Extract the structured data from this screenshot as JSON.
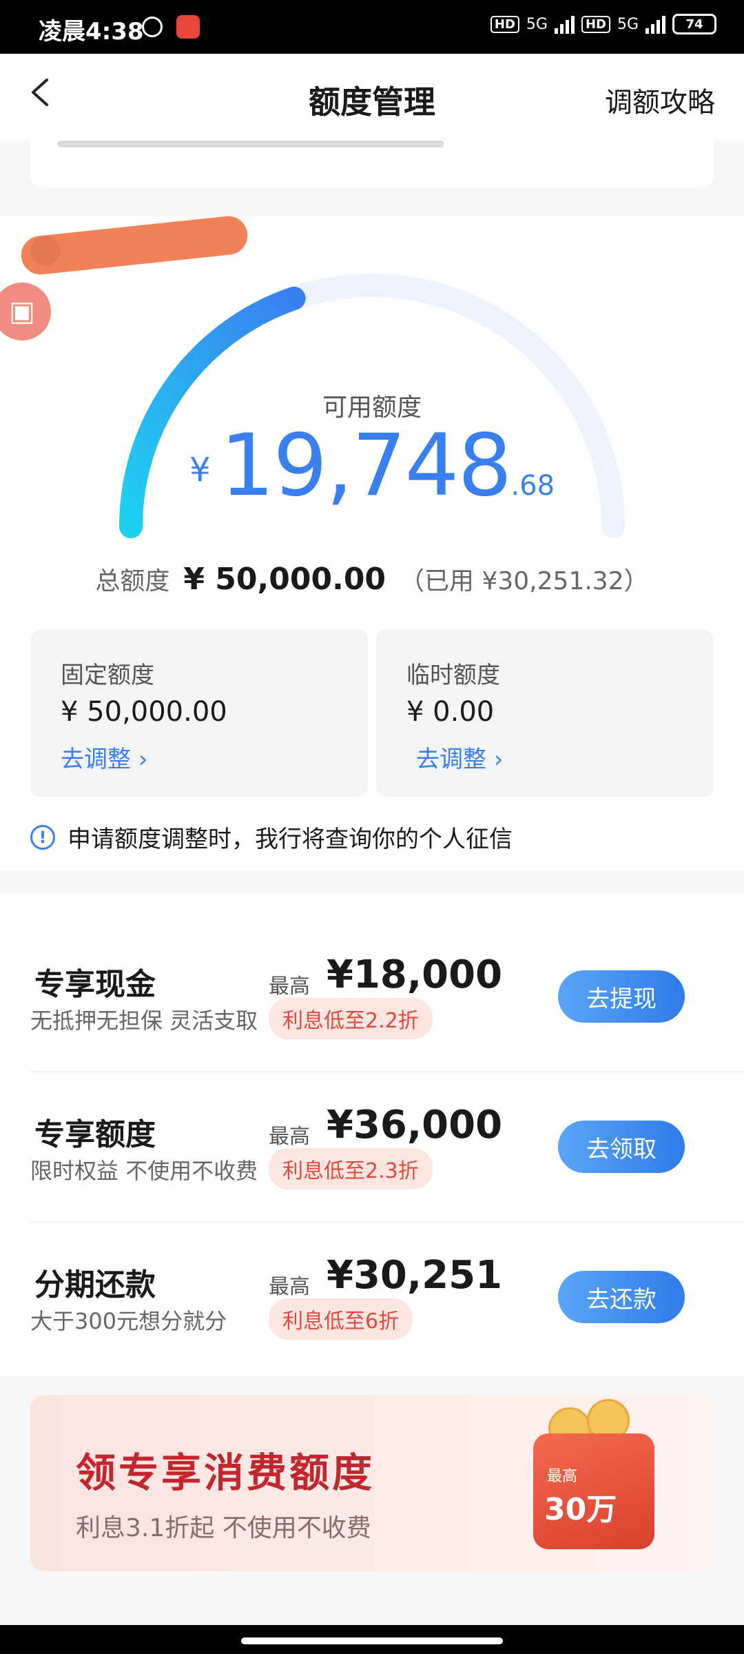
{
  "status_bar": {
    "time": "凌晨4:38",
    "hd1": "HD",
    "net1": "5G",
    "hd2": "HD",
    "net2": "5G",
    "battery": "74"
  },
  "header": {
    "title": "额度管理",
    "right_link": "调额攻略"
  },
  "credit": {
    "available_label": "可用额度",
    "available_currency": "¥",
    "available_int": "19,748",
    "available_dec": ".68",
    "available_fraction_of_total": 0.395,
    "total_label": "总额度",
    "total_value": "¥ 50,000.00",
    "used_text": "（已用 ¥30,251.32）"
  },
  "boxes": [
    {
      "title": "固定额度",
      "value": "¥ 50,000.00",
      "action": "去调整"
    },
    {
      "title": "临时额度",
      "value": "¥ 0.00",
      "action": "去调整"
    }
  ],
  "notice": "申请额度调整时，我行将查询你的个人征信",
  "offers": [
    {
      "name": "专享现金",
      "desc": "无抵押无担保 灵活支取",
      "max_label": "最高",
      "amount": "¥18,000",
      "rate": "利息低至2.2折",
      "button": "去提现"
    },
    {
      "name": "专享额度",
      "desc": "限时权益 不使用不收费",
      "max_label": "最高",
      "amount": "¥36,000",
      "rate": "利息低至2.3折",
      "button": "去领取"
    },
    {
      "name": "分期还款",
      "desc": "大于300元想分就分",
      "max_label": "最高",
      "amount": "¥30,251",
      "rate": "利息低至6折",
      "button": "去还款"
    }
  ],
  "banner": {
    "title": "领专享消费额度",
    "subtitle": "利息3.1折起 不使用不收费",
    "badge_top": "最高",
    "badge_amount": "30万"
  },
  "colors": {
    "accent": "#3a7ff0",
    "rate": "#e5473c",
    "banner_title": "#c1272d"
  }
}
